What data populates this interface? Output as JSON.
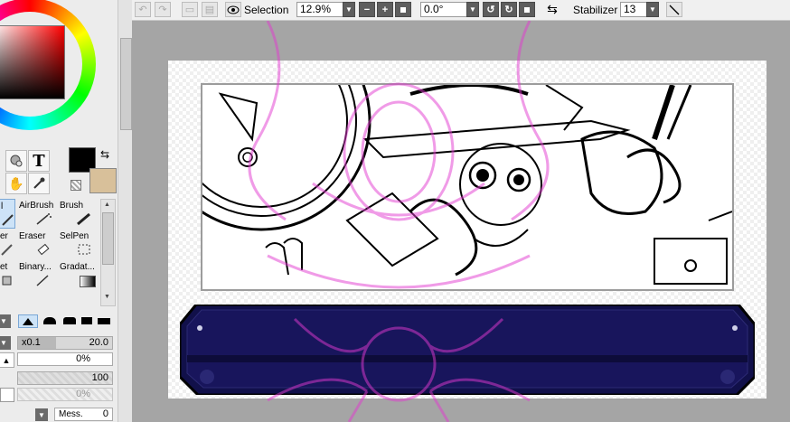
{
  "toolbar": {
    "selection_label": "Selection",
    "zoom_value": "12.9%",
    "rotation_value": "0.0°",
    "stabilizer_label": "Stabilizer",
    "stabilizer_value": "13",
    "icons": [
      "undo-icon",
      "redo-icon",
      "deselect-icon",
      "invert-icon",
      "eye-icon",
      "zoom-out-icon",
      "zoom-in-icon",
      "zoom-reset-icon",
      "rotate-left-icon",
      "rotate-right-icon",
      "rotate-reset-icon",
      "flip-icon",
      "line-icon"
    ]
  },
  "tools_top": {
    "text_tool_glyph": "T"
  },
  "tools": [
    {
      "label": "l"
    },
    {
      "label": "AirBrush"
    },
    {
      "label": "Brush"
    },
    {
      "label": "er"
    },
    {
      "label": "Eraser"
    },
    {
      "label": "SelPen"
    },
    {
      "label": "et"
    },
    {
      "label": "Binary..."
    },
    {
      "label": "Gradat..."
    }
  ],
  "brush_settings": {
    "size_multiplier": "x0.1",
    "size_value": "20.0",
    "min_size_value": "0%",
    "density_value": "100",
    "extra_value": "0%",
    "mess_label": "Mess.",
    "mess_value": "0"
  },
  "colors": {
    "primary": "#000000",
    "secondary": "#d8c09a",
    "accent": "#1e1648",
    "watermark": "#e23ad0",
    "canvas_bg": "#a5a5a5"
  }
}
